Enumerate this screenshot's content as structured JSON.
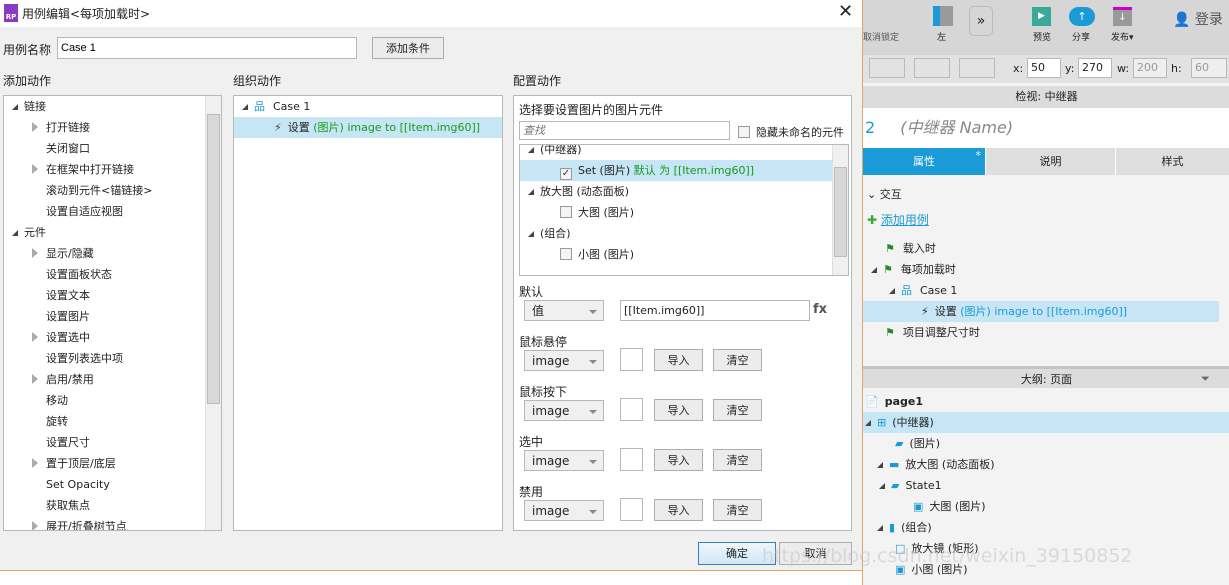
{
  "dialog": {
    "logo": "RP",
    "title": "用例编辑<每项加载时>",
    "case_name_label": "用例名称",
    "case_name_value": "Case 1",
    "add_condition": "添加条件",
    "add_action_header": "添加动作",
    "organize_header": "组织动作",
    "configure_header": "配置动作",
    "actions": [
      {
        "label": "链接",
        "level": 0,
        "exp": "open"
      },
      {
        "label": "打开链接",
        "level": 1,
        "exp": "closed"
      },
      {
        "label": "关闭窗口",
        "level": 1
      },
      {
        "label": "在框架中打开链接",
        "level": 1,
        "exp": "closed"
      },
      {
        "label": "滚动到元件<锚链接>",
        "level": 1
      },
      {
        "label": "设置自适应视图",
        "level": 1
      },
      {
        "label": "元件",
        "level": 0,
        "exp": "open"
      },
      {
        "label": "显示/隐藏",
        "level": 1,
        "exp": "closed"
      },
      {
        "label": "设置面板状态",
        "level": 1
      },
      {
        "label": "设置文本",
        "level": 1
      },
      {
        "label": "设置图片",
        "level": 1
      },
      {
        "label": "设置选中",
        "level": 1,
        "exp": "closed"
      },
      {
        "label": "设置列表选中项",
        "level": 1
      },
      {
        "label": "启用/禁用",
        "level": 1,
        "exp": "closed"
      },
      {
        "label": "移动",
        "level": 1
      },
      {
        "label": "旋转",
        "level": 1
      },
      {
        "label": "设置尺寸",
        "level": 1
      },
      {
        "label": "置于顶层/底层",
        "level": 1,
        "exp": "closed"
      },
      {
        "label": "Set Opacity",
        "level": 1
      },
      {
        "label": "获取焦点",
        "level": 1
      },
      {
        "label": "展开/折叠树节点",
        "level": 1,
        "exp": "closed"
      }
    ],
    "organize": {
      "case": "Case 1",
      "action_prefix": "设置",
      "action_detail": "(图片) image to [[Item.img60]]"
    },
    "configure": {
      "select_label": "选择要设置图片的图片元件",
      "search_placeholder": "查找",
      "hide_unnamed": "隐藏未命名的元件",
      "widgets": [
        {
          "label": "(中继器)",
          "group": true
        },
        {
          "label": "Set (图片)",
          "extra": "默认 为 [[Item.img60]]",
          "checked": true
        },
        {
          "label": "放大图 (动态面板)",
          "group": true
        },
        {
          "label": "大图 (图片)",
          "checked": false
        },
        {
          "label": "(组合)",
          "group": true
        },
        {
          "label": "小图 (图片)",
          "checked": false
        }
      ],
      "default_label": "默认",
      "default_select": "值",
      "default_value": "[[Item.img60]]",
      "fx": "fx",
      "states": [
        {
          "label": "鼠标悬停",
          "select": "image"
        },
        {
          "label": "鼠标按下",
          "select": "image"
        },
        {
          "label": "选中",
          "select": "image"
        },
        {
          "label": "禁用",
          "select": "image"
        }
      ],
      "import": "导入",
      "clear": "清空"
    },
    "ok": "确定",
    "cancel": "取消"
  },
  "right": {
    "toolbar": {
      "unlock": "取消锁定",
      "left": "左",
      "preview": "预览",
      "share": "分享",
      "publish": "发布",
      "login": "登录"
    },
    "coords": {
      "x_label": "x:",
      "x": "50",
      "y_label": "y:",
      "y": "270",
      "w_label": "w:",
      "w": "200",
      "h_label": "h:",
      "h": "60"
    },
    "inspector_title": "检视: 中继器",
    "name_num": "2",
    "name_placeholder": "(中继器 Name)",
    "tabs": [
      "属性",
      "说明",
      "样式"
    ],
    "tab_star": "*",
    "interactions_label": "交互",
    "add_case": "添加用例",
    "events": [
      {
        "label": "载入时"
      },
      {
        "label": "每项加载时"
      },
      {
        "label": "Case 1"
      },
      {
        "prefix": "设置",
        "detail": "(图片) image to [[Item.img60]]"
      },
      {
        "label": "项目调整尺寸时"
      }
    ],
    "outline_title": "大纲: 页面",
    "outline": [
      {
        "label": "page1"
      },
      {
        "label": "(中继器)"
      },
      {
        "label": "(图片)"
      },
      {
        "label": "放大图 (动态面板)"
      },
      {
        "label": "State1"
      },
      {
        "label": "大图 (图片)"
      },
      {
        "label": "(组合)"
      },
      {
        "label": "放大镜 (矩形)"
      },
      {
        "label": "小图 (图片)"
      }
    ]
  },
  "watermark": "https://blog.csdn.net/weixin_39150852",
  "colors": {
    "accent": "#1a9ad6",
    "selection": "#c6e6f5",
    "green": "#1a9a1a"
  }
}
